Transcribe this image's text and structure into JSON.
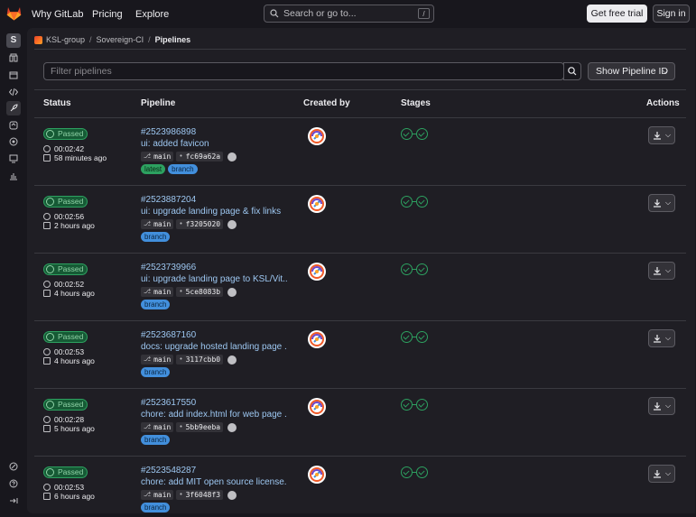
{
  "nav": {
    "items": [
      "Why GitLab",
      "Pricing",
      "Explore"
    ],
    "search_placeholder": "Search or go to...",
    "search_shortcut": "/",
    "trial_label": "Get free trial",
    "signin_label": "Sign in"
  },
  "rail": {
    "avatar_letter": "S",
    "icons": [
      "pin-icon",
      "issues-icon",
      "code-icon",
      "rocket-icon",
      "deploy-icon",
      "operate-icon",
      "monitor-icon",
      "analytics-icon"
    ],
    "bottom_icons": [
      "help-icon",
      "question-icon",
      "collapse-icon"
    ]
  },
  "breadcrumb": [
    "KSL-group",
    "Sovereign-CI",
    "Pipelines"
  ],
  "filter": {
    "placeholder": "Filter pipelines",
    "show_id_label": "Show Pipeline ID"
  },
  "table": {
    "headers": [
      "Status",
      "Pipeline",
      "Created by",
      "Stages",
      "Actions"
    ],
    "rows": [
      {
        "status": "Passed",
        "duration": "00:02:42",
        "finished": "58 minutes ago",
        "id": "#2523986898",
        "title": "ui: added favicon",
        "branch": "main",
        "sha": "fc69a62a",
        "tags": [
          "latest",
          "branch"
        ]
      },
      {
        "status": "Passed",
        "duration": "00:02:56",
        "finished": "2 hours ago",
        "id": "#2523887204",
        "title": "ui: upgrade landing page & fix links",
        "branch": "main",
        "sha": "f3205020",
        "tags": [
          "branch"
        ]
      },
      {
        "status": "Passed",
        "duration": "00:02:52",
        "finished": "4 hours ago",
        "id": "#2523739966",
        "title": "ui: upgrade landing page to KSL/Vit...",
        "branch": "main",
        "sha": "5ce8083b",
        "tags": [
          "branch"
        ]
      },
      {
        "status": "Passed",
        "duration": "00:02:53",
        "finished": "4 hours ago",
        "id": "#2523687160",
        "title": "docs: upgrade hosted landing page ...",
        "branch": "main",
        "sha": "3117cbb0",
        "tags": [
          "branch"
        ]
      },
      {
        "status": "Passed",
        "duration": "00:02:28",
        "finished": "5 hours ago",
        "id": "#2523617550",
        "title": "chore: add index.html for web page ...",
        "branch": "main",
        "sha": "5bb9eeba",
        "tags": [
          "branch"
        ]
      },
      {
        "status": "Passed",
        "duration": "00:02:53",
        "finished": "6 hours ago",
        "id": "#2523548287",
        "title": "chore: add MIT open source license...",
        "branch": "main",
        "sha": "3f6048f3",
        "tags": [
          "branch"
        ]
      }
    ]
  },
  "colors": {
    "passed": "#2da160",
    "link": "#9dc7f1",
    "branch_tag": "#428fdc"
  }
}
